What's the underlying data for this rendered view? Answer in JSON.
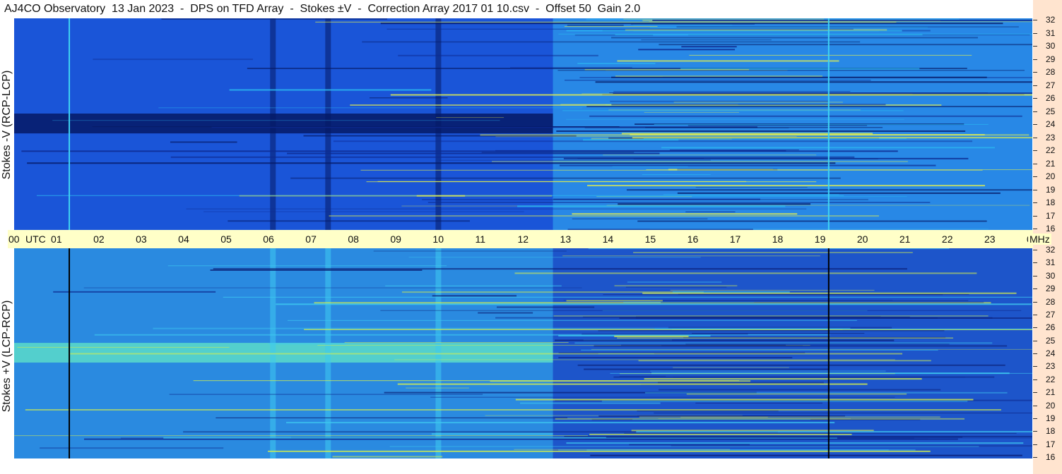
{
  "header": {
    "title": "AJ4CO Observatory  13 Jan 2023  -  DPS on TFD Array  -  Stokes ±V  -  Correction Array 2017 01 10.csv  -  Offset 50  Gain 2.0"
  },
  "chart_data": [
    {
      "type": "heatmap",
      "ylabel": "Stokes -V (RCP-LCP)",
      "xlabel": "UTC",
      "x_ticks": [
        "00",
        "01",
        "02",
        "03",
        "04",
        "05",
        "06",
        "07",
        "08",
        "09",
        "10",
        "11",
        "12",
        "13",
        "14",
        "15",
        "16",
        "17",
        "18",
        "19",
        "20",
        "21",
        "22",
        "23",
        "00"
      ],
      "y_ticks": [
        "32",
        "31",
        "30",
        "29",
        "28",
        "27",
        "26",
        "25",
        "24",
        "23",
        "22",
        "21",
        "20",
        "19",
        "18",
        "17",
        "16"
      ],
      "y_unit": "MHz",
      "ylim": [
        16,
        32
      ],
      "xlim": [
        0,
        24
      ],
      "colors": {
        "base": "#1a55d8",
        "dark": "#061a66",
        "bright": "#2bb8f0",
        "hot": "#e6f04a"
      },
      "features": {
        "dark_band_mhz": [
          23.3,
          24.8
        ],
        "dark_spikes_utc": [
          6.1,
          7.4,
          10.0
        ],
        "marker_lines_utc": [
          1.3,
          19.2
        ],
        "regime_change_utc": 12.7
      }
    },
    {
      "type": "heatmap",
      "ylabel": "Stokes +V (LCP-RCP)",
      "xlabel": "UTC",
      "x_ticks": [
        "00",
        "01",
        "02",
        "03",
        "04",
        "05",
        "06",
        "07",
        "08",
        "09",
        "10",
        "11",
        "12",
        "13",
        "14",
        "15",
        "16",
        "17",
        "18",
        "19",
        "20",
        "21",
        "22",
        "23",
        "00"
      ],
      "y_ticks": [
        "32",
        "31",
        "30",
        "29",
        "28",
        "27",
        "26",
        "25",
        "24",
        "23",
        "22",
        "21",
        "20",
        "19",
        "18",
        "17",
        "16"
      ],
      "y_unit": "MHz",
      "ylim": [
        16,
        32
      ],
      "xlim": [
        0,
        24
      ],
      "colors": {
        "base": "#2a8ae0",
        "dark": "#0a1a70",
        "bright": "#3ecaf0",
        "hot": "#d8f04a"
      },
      "features": {
        "bright_band_mhz": [
          23.3,
          24.8
        ],
        "bright_spikes_utc": [
          6.1,
          7.4,
          10.0
        ],
        "marker_lines_utc": [
          1.3,
          19.2
        ],
        "regime_change_utc": 12.7
      }
    }
  ],
  "axis": {
    "utc_label": "UTC",
    "mhz_label": "MHz"
  }
}
